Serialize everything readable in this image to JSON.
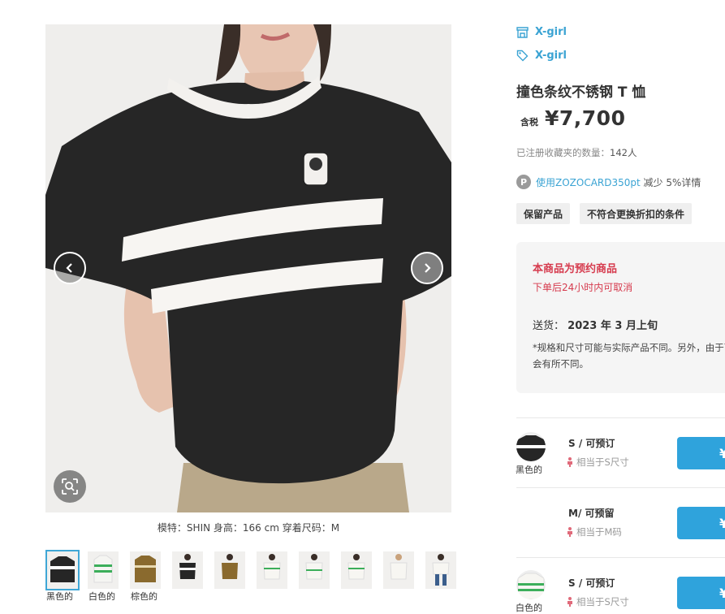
{
  "brand": {
    "label_1": "X-girl",
    "label_2": "X-girl"
  },
  "product": {
    "title": "撞色条纹不锈钢 T 恤",
    "tax_label": "含税",
    "price": "¥7,700",
    "favorites_label": "已注册收藏夹的数量：",
    "favorites_count": "142人",
    "points_badge": "P",
    "points_link": "使用ZOZOCARD350pt",
    "points_rest": " 减少 5%详情",
    "tags": [
      "保留产品",
      "不符合更换折扣的条件"
    ]
  },
  "notice": {
    "title": "本商品为预约商品",
    "subtitle": "下单后24小时内可取消",
    "ship_label": "送货：",
    "ship_value": "2023 年 3 月上旬",
    "note": "*规格和尺寸可能与实际产品不同。另外，由于可能会有所不同。"
  },
  "model_info": "模特：SHIN 身高：166 cm 穿着尺码：M",
  "thumb_labels": [
    "黑色的",
    "白色的",
    "棕色的"
  ],
  "variants": [
    {
      "color": "黑色的",
      "size": "S / 可预订",
      "equiv": "相当于S尺寸",
      "button": "¥"
    },
    {
      "color": "",
      "size": "M/ 可预留",
      "equiv": "相当于M码",
      "button": "¥"
    },
    {
      "color": "白色的",
      "size": "S / 可预订",
      "equiv": "相当于S尺寸",
      "button": "¥"
    }
  ],
  "colors": {
    "accent": "#3aa3d3",
    "button": "#2fa3dc",
    "alert": "#d63b4e"
  },
  "icons": {
    "brand_1": "store-icon",
    "brand_2": "tag-icon",
    "prev": "chevron-left-icon",
    "next": "chevron-right-icon",
    "zoom": "zoom-scan-icon",
    "person": "person-icon"
  }
}
